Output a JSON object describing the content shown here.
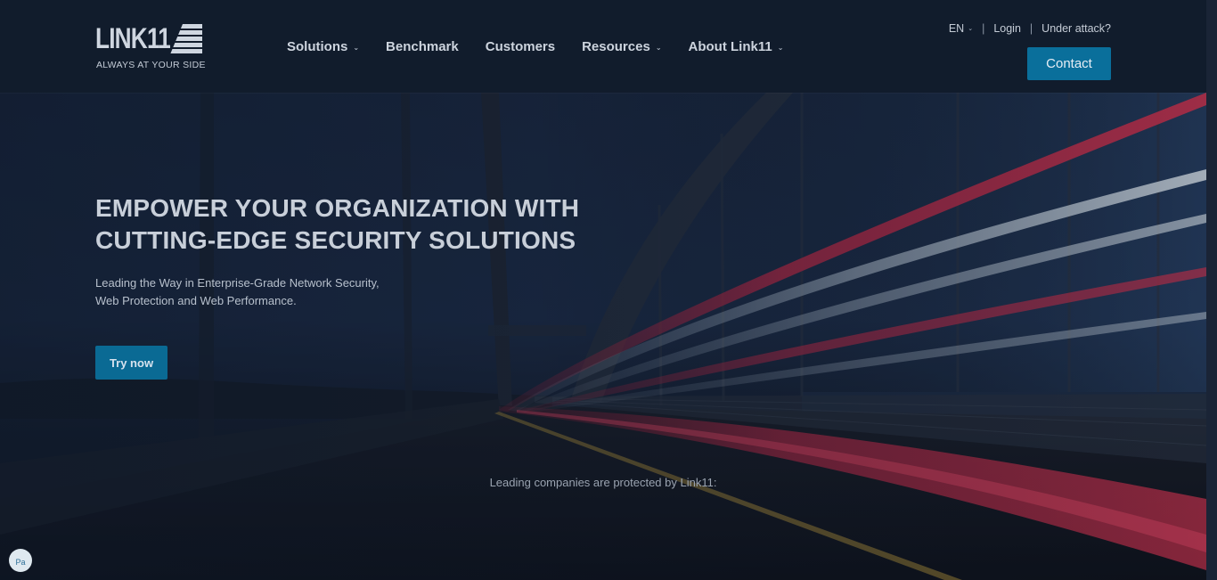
{
  "header": {
    "logo": {
      "wordmark": "LINK11",
      "tagline": "ALWAYS AT YOUR SIDE"
    },
    "nav": [
      {
        "label": "Solutions",
        "has_dropdown": true
      },
      {
        "label": "Benchmark",
        "has_dropdown": false
      },
      {
        "label": "Customers",
        "has_dropdown": false
      },
      {
        "label": "Resources",
        "has_dropdown": true
      },
      {
        "label": "About Link11",
        "has_dropdown": true
      }
    ],
    "utility": {
      "language": "EN",
      "login": "Login",
      "under_attack": "Under attack?"
    },
    "contact_label": "Contact"
  },
  "hero": {
    "title_line1": "EMPOWER YOUR ORGANIZATION WITH",
    "title_line2": "CUTTING-EDGE SECURITY SOLUTIONS",
    "subtitle_line1": "Leading the Way in Enterprise-Grade Network Security,",
    "subtitle_line2": "Web Protection and Web Performance.",
    "cta_label": "Try now",
    "protected_text": "Leading companies are protected by Link11:"
  },
  "widget": {
    "badge_label": "Pa"
  },
  "colors": {
    "header_bg": "#111c2c",
    "accent": "#0a6f9b",
    "text": "#c8cfd9"
  },
  "icons": {
    "dropdown": "chevron-down-icon",
    "logo_mark": "stripes-logo-icon"
  }
}
